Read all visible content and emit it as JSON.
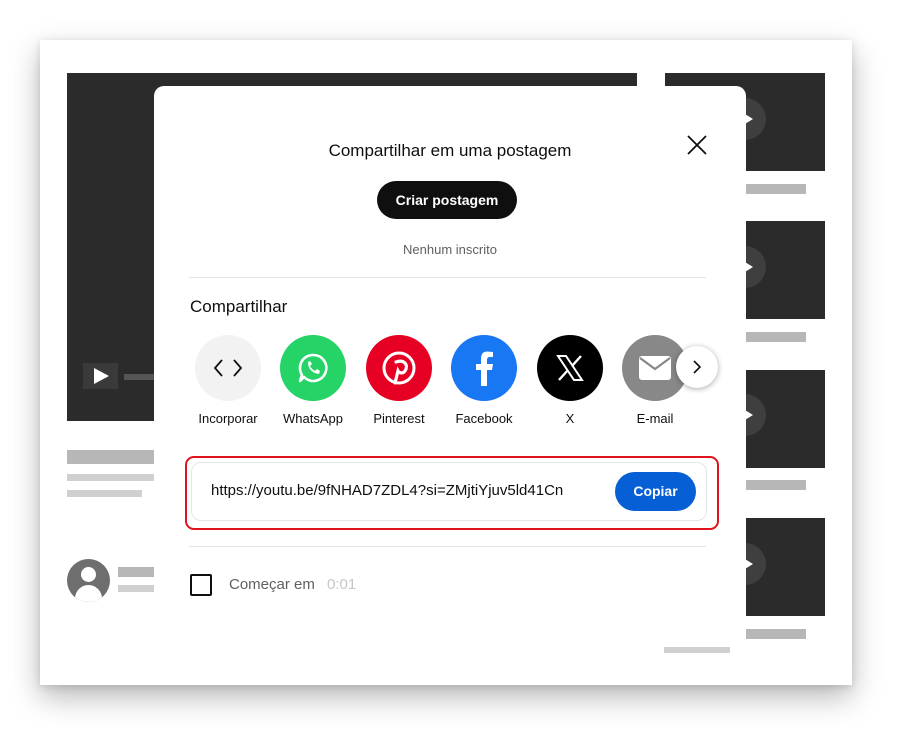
{
  "share_dialog": {
    "post_title": "Compartilhar em uma postagem",
    "create_post_label": "Criar postagem",
    "subscribers_text": "Nenhum inscrito",
    "share_heading": "Compartilhar",
    "targets": [
      {
        "label": "Incorporar",
        "icon": "embed-icon",
        "color": "#f2f2f2"
      },
      {
        "label": "WhatsApp",
        "icon": "whatsapp-icon",
        "color": "#25d366"
      },
      {
        "label": "Pinterest",
        "icon": "pinterest-icon",
        "color": "#e60023"
      },
      {
        "label": "Facebook",
        "icon": "facebook-icon",
        "color": "#1877f2"
      },
      {
        "label": "X",
        "icon": "x-icon",
        "color": "#000000"
      },
      {
        "label": "E-mail",
        "icon": "email-icon",
        "color": "#888888"
      }
    ],
    "url": "https://youtu.be/9fNHAD7ZDL4?si=ZMjtiYjuv5ld41Cn",
    "copy_label": "Copiar",
    "start_at_label": "Começar em",
    "start_at_time": "0:01",
    "accent_color": "#065fd4",
    "highlight_color": "#e0121d"
  }
}
